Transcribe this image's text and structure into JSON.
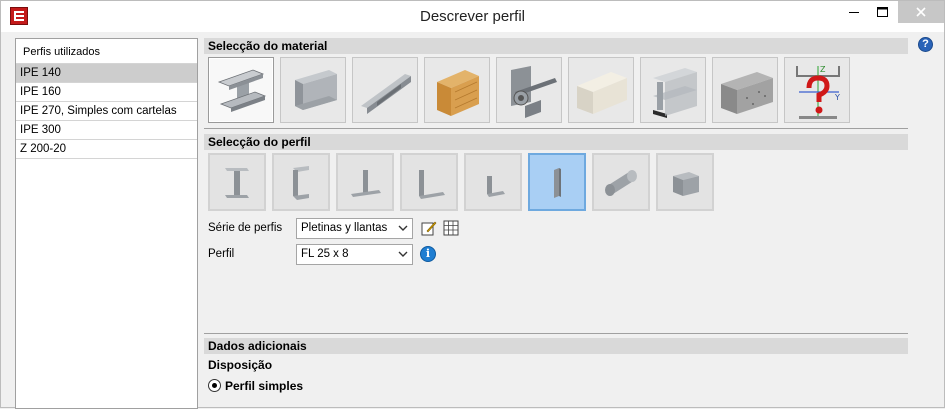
{
  "window": {
    "title": "Descrever perfil"
  },
  "left": {
    "header": "Perfis utilizados",
    "items": [
      {
        "label": "IPE 140",
        "selected": true
      },
      {
        "label": "IPE 160",
        "selected": false
      },
      {
        "label": "IPE 270, Simples com cartelas",
        "selected": false
      },
      {
        "label": "IPE 300",
        "selected": false
      },
      {
        "label": "Z 200-20",
        "selected": false
      }
    ]
  },
  "material": {
    "header": "Selecção do material",
    "buttons": [
      {
        "name": "rolled-steel",
        "icon": "steel-i-beam-icon",
        "selected": true
      },
      {
        "name": "cold-formed-steel",
        "icon": "cold-formed-c-icon",
        "selected": false
      },
      {
        "name": "light-steel",
        "icon": "light-steel-rail-icon",
        "selected": false
      },
      {
        "name": "timber",
        "icon": "wood-beam-icon",
        "selected": false
      },
      {
        "name": "connection",
        "icon": "bolted-connection-icon",
        "selected": false
      },
      {
        "name": "generic",
        "icon": "generic-box-icon",
        "selected": false
      },
      {
        "name": "aluminium",
        "icon": "aluminium-profile-icon",
        "selected": false
      },
      {
        "name": "concrete",
        "icon": "concrete-block-icon",
        "selected": false
      },
      {
        "name": "user-defined",
        "icon": "user-section-axes-icon",
        "selected": false
      }
    ]
  },
  "profile": {
    "header": "Selecção do perfil",
    "buttons": [
      {
        "name": "i-section",
        "icon": "i-section-icon",
        "selected": false
      },
      {
        "name": "c-section",
        "icon": "c-section-icon",
        "selected": false
      },
      {
        "name": "t-section",
        "icon": "t-section-icon",
        "selected": false
      },
      {
        "name": "l-section",
        "icon": "l-section-icon",
        "selected": false
      },
      {
        "name": "small-l-section",
        "icon": "small-l-section-icon",
        "selected": false
      },
      {
        "name": "flat-bar",
        "icon": "flat-bar-icon",
        "selected": true
      },
      {
        "name": "round-bar",
        "icon": "round-bar-icon",
        "selected": false
      },
      {
        "name": "square-bar",
        "icon": "square-bar-icon",
        "selected": false
      }
    ],
    "series_label": "Série de perfis",
    "series_value": "Pletinas y llantas",
    "profile_label": "Perfil",
    "profile_value": "FL 25 x 8"
  },
  "additional": {
    "header": "Dados adicionais",
    "disposicao_label": "Disposição",
    "radio_label": "Perfil simples"
  },
  "colors": {
    "selected_profile_bg": "#a9cff4",
    "section_header_bg": "#d9d9d9"
  }
}
